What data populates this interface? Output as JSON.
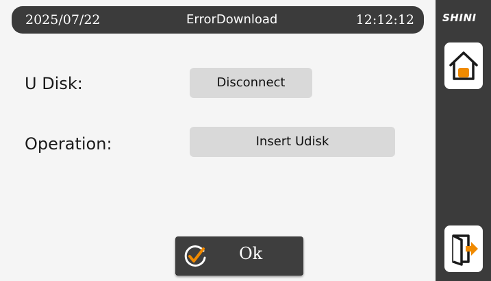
{
  "header": {
    "date": "2025/07/22",
    "title": "ErrorDownload",
    "time": "12:12:12"
  },
  "form": {
    "udisk_label": "U Disk:",
    "udisk_value": "Disconnect",
    "operation_label": "Operation:",
    "operation_value": "Insert Udisk"
  },
  "ok_button": {
    "label": "Ok",
    "icon": "check-circle-icon"
  },
  "sidebar": {
    "logo_text": "SHINI",
    "home_icon": "home-icon",
    "exit_icon": "exit-icon"
  },
  "colors": {
    "dark": "#3b3b3b",
    "accent": "#f08a00",
    "field": "#d9d9d9",
    "background": "#f5f5f5"
  }
}
